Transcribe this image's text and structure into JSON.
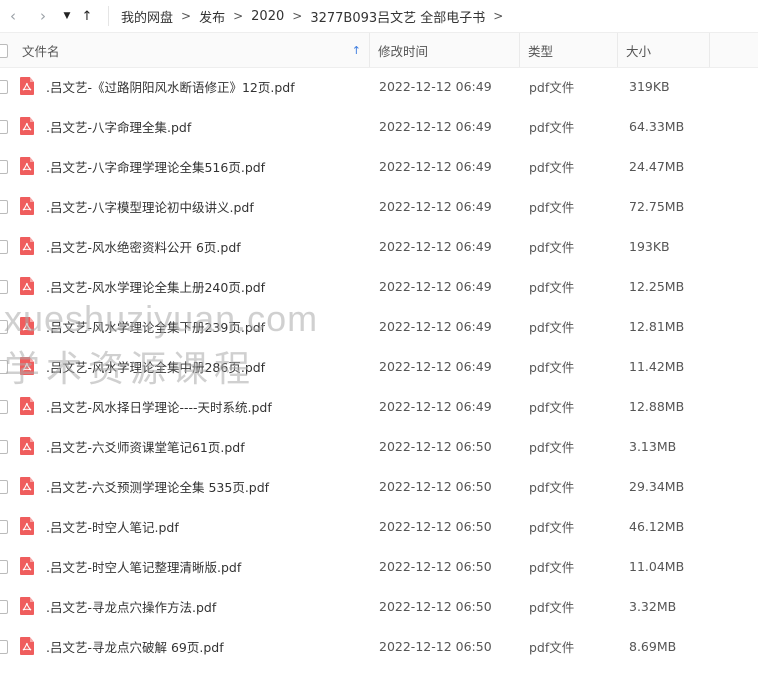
{
  "nav": {
    "back_icon": "‹",
    "forward_icon": "›",
    "dropdown_icon": "▼",
    "up_icon": "↑"
  },
  "breadcrumb": [
    "我的网盘",
    "发布",
    "2020",
    "3277B093吕文艺 全部电子书"
  ],
  "breadcrumb_sep": ">",
  "columns": {
    "name": "文件名",
    "modified": "修改时间",
    "type": "类型",
    "size": "大小"
  },
  "sort_indicator": "↑",
  "files": [
    {
      "name": ".吕文艺-《过路阴阳风水断语修正》12页.pdf",
      "modified": "2022-12-12 06:49",
      "type": "pdf文件",
      "size": "319KB"
    },
    {
      "name": ".吕文艺-八字命理全集.pdf",
      "modified": "2022-12-12 06:49",
      "type": "pdf文件",
      "size": "64.33MB"
    },
    {
      "name": ".吕文艺-八字命理学理论全集516页.pdf",
      "modified": "2022-12-12 06:49",
      "type": "pdf文件",
      "size": "24.47MB"
    },
    {
      "name": ".吕文艺-八字模型理论初中级讲义.pdf",
      "modified": "2022-12-12 06:49",
      "type": "pdf文件",
      "size": "72.75MB"
    },
    {
      "name": ".吕文艺-风水绝密资料公开 6页.pdf",
      "modified": "2022-12-12 06:49",
      "type": "pdf文件",
      "size": "193KB"
    },
    {
      "name": ".吕文艺-风水学理论全集上册240页.pdf",
      "modified": "2022-12-12 06:49",
      "type": "pdf文件",
      "size": "12.25MB"
    },
    {
      "name": ".吕文艺-风水学理论全集下册239页.pdf",
      "modified": "2022-12-12 06:49",
      "type": "pdf文件",
      "size": "12.81MB"
    },
    {
      "name": ".吕文艺-风水学理论全集中册286页.pdf",
      "modified": "2022-12-12 06:49",
      "type": "pdf文件",
      "size": "11.42MB"
    },
    {
      "name": ".吕文艺-风水择日学理论----天时系统.pdf",
      "modified": "2022-12-12 06:49",
      "type": "pdf文件",
      "size": "12.88MB"
    },
    {
      "name": ".吕文艺-六爻师资课堂笔记61页.pdf",
      "modified": "2022-12-12 06:50",
      "type": "pdf文件",
      "size": "3.13MB"
    },
    {
      "name": ".吕文艺-六爻预测学理论全集 535页.pdf",
      "modified": "2022-12-12 06:50",
      "type": "pdf文件",
      "size": "29.34MB"
    },
    {
      "name": ".吕文艺-时空人笔记.pdf",
      "modified": "2022-12-12 06:50",
      "type": "pdf文件",
      "size": "46.12MB"
    },
    {
      "name": ".吕文艺-时空人笔记整理清晰版.pdf",
      "modified": "2022-12-12 06:50",
      "type": "pdf文件",
      "size": "11.04MB"
    },
    {
      "name": ".吕文艺-寻龙点穴操作方法.pdf",
      "modified": "2022-12-12 06:50",
      "type": "pdf文件",
      "size": "3.32MB"
    },
    {
      "name": ".吕文艺-寻龙点穴破解 69页.pdf",
      "modified": "2022-12-12 06:50",
      "type": "pdf文件",
      "size": "8.69MB"
    }
  ],
  "watermark": {
    "line1": "xueshuziyuan.com",
    "line2": "学术资源课程"
  },
  "colors": {
    "accent": "#3c7ce0",
    "pdf_icon": "#ef5d5d"
  }
}
